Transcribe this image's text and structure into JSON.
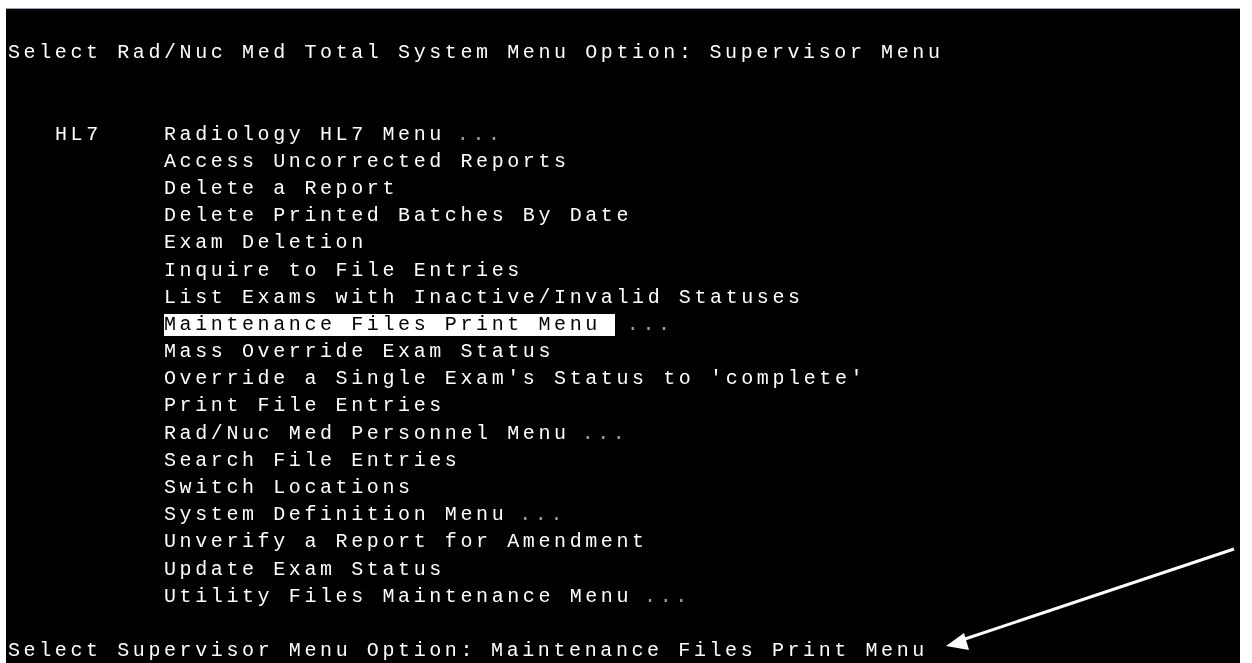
{
  "first_prompt": {
    "prompt": "Select Rad/Nuc Med Total System Menu Option:",
    "answer": "Supervisor Menu"
  },
  "menu_items": [
    {
      "code": "HL7",
      "label": "Radiology HL7 Menu",
      "more": "...",
      "selected": false
    },
    {
      "label": "Access Uncorrected Reports",
      "selected": false
    },
    {
      "label": "Delete a Report",
      "selected": false
    },
    {
      "label": "Delete Printed Batches By Date",
      "selected": false
    },
    {
      "label": "Exam Deletion",
      "selected": false
    },
    {
      "label": "Inquire to File Entries",
      "selected": false
    },
    {
      "label": "List Exams with Inactive/Invalid Statuses",
      "selected": false
    },
    {
      "label": "Maintenance Files Print Menu",
      "more": "...",
      "selected": true
    },
    {
      "label": "Mass Override Exam Status",
      "selected": false
    },
    {
      "label": "Override a Single Exam's Status to 'complete'",
      "selected": false
    },
    {
      "label": "Print File Entries",
      "selected": false
    },
    {
      "label": "Rad/Nuc Med Personnel Menu",
      "more": "...",
      "selected": false
    },
    {
      "label": "Search File Entries",
      "selected": false
    },
    {
      "label": "Switch Locations",
      "selected": false
    },
    {
      "label": "System Definition Menu",
      "more": "...",
      "selected": false
    },
    {
      "label": "Unverify a Report for Amendment",
      "selected": false
    },
    {
      "label": "Update Exam Status",
      "selected": false
    },
    {
      "label": "Utility Files Maintenance Menu",
      "more": "...",
      "selected": false
    }
  ],
  "last_prompt": {
    "prompt": "Select Supervisor Menu Option:",
    "answer": "Maintenance Files Print Menu"
  }
}
